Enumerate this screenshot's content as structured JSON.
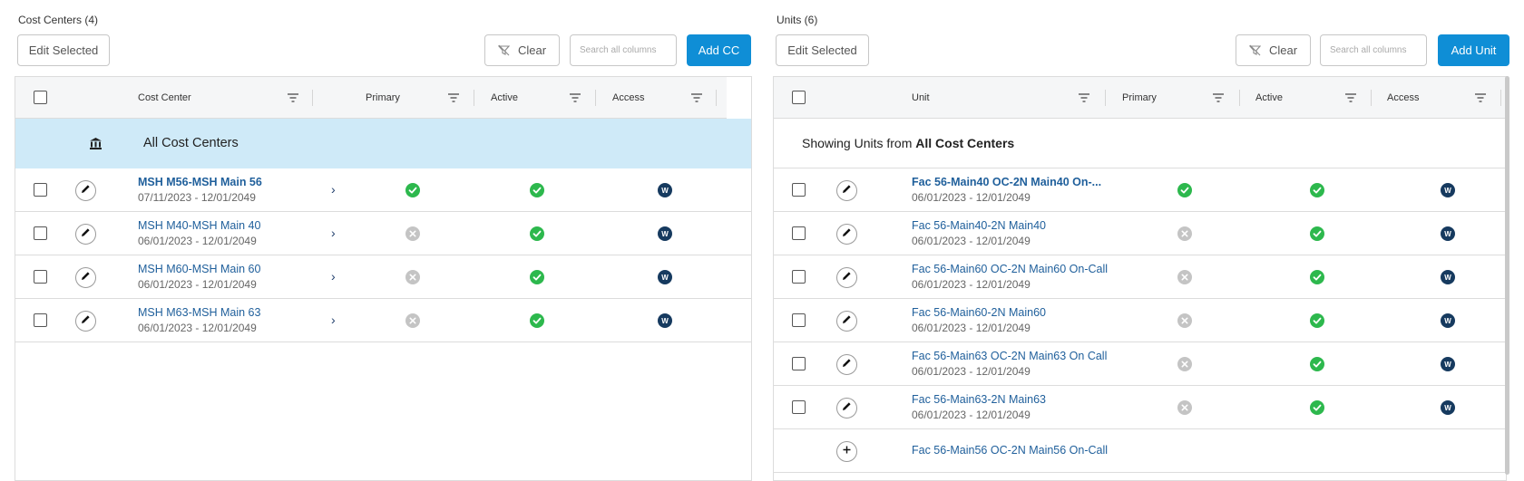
{
  "left_panel": {
    "title": "Cost Centers (4)",
    "edit_selected_label": "Edit Selected",
    "clear_label": "Clear",
    "search_placeholder": "Search all columns",
    "add_label": "Add CC",
    "columns": {
      "name": "Cost Center",
      "primary": "Primary",
      "active": "Active",
      "access": "Access"
    },
    "all_row_label": "All Cost Centers",
    "rows": [
      {
        "name": "MSH M56-MSH Main 56",
        "dates": "07/11/2023 - 12/01/2049",
        "primary": true,
        "active": true,
        "access": "W"
      },
      {
        "name": "MSH M40-MSH Main 40",
        "dates": "06/01/2023 - 12/01/2049",
        "primary": false,
        "active": true,
        "access": "W"
      },
      {
        "name": "MSH M60-MSH Main 60",
        "dates": "06/01/2023 - 12/01/2049",
        "primary": false,
        "active": true,
        "access": "W"
      },
      {
        "name": "MSH M63-MSH Main 63",
        "dates": "06/01/2023 - 12/01/2049",
        "primary": false,
        "active": true,
        "access": "W"
      }
    ]
  },
  "right_panel": {
    "title": "Units (6)",
    "edit_selected_label": "Edit Selected",
    "clear_label": "Clear",
    "search_placeholder": "Search all columns",
    "add_label": "Add Unit",
    "columns": {
      "name": "Unit",
      "primary": "Primary",
      "active": "Active",
      "access": "Access"
    },
    "showing_prefix": "Showing Units from ",
    "showing_source": "All Cost Centers",
    "rows": [
      {
        "name": "Fac 56-Main40 OC-2N Main40 On-...",
        "dates": "06/01/2023 - 12/01/2049",
        "primary": true,
        "active": true,
        "access": "W"
      },
      {
        "name": "Fac 56-Main40-2N Main40",
        "dates": "06/01/2023 - 12/01/2049",
        "primary": false,
        "active": true,
        "access": "W"
      },
      {
        "name": "Fac 56-Main60 OC-2N Main60 On-Call",
        "dates": "06/01/2023 - 12/01/2049",
        "primary": false,
        "active": true,
        "access": "W"
      },
      {
        "name": "Fac 56-Main60-2N Main60",
        "dates": "06/01/2023 - 12/01/2049",
        "primary": false,
        "active": true,
        "access": "W"
      },
      {
        "name": "Fac 56-Main63 OC-2N Main63 On Call",
        "dates": "06/01/2023 - 12/01/2049",
        "primary": false,
        "active": true,
        "access": "W"
      },
      {
        "name": "Fac 56-Main63-2N Main63",
        "dates": "06/01/2023 - 12/01/2049",
        "primary": false,
        "active": true,
        "access": "W"
      }
    ],
    "add_row_label": "Fac 56-Main56 OC-2N Main56 On-Call"
  },
  "colors": {
    "accent": "#0f8ed6",
    "link": "#1f5f9b",
    "selected_row_bg": "#cfeaf8",
    "check_green": "#2db84d",
    "inactive_gray": "#c4c4c4",
    "access_badge": "#163a5f"
  },
  "icons": {
    "filter": "filter-icon",
    "clear": "clear-filter-icon",
    "edit": "pencil-icon",
    "all": "bank-icon",
    "primary_on": "check-circle-icon",
    "primary_off": "x-circle-icon",
    "add": "plus-icon",
    "expand": "chevron-right-icon"
  }
}
